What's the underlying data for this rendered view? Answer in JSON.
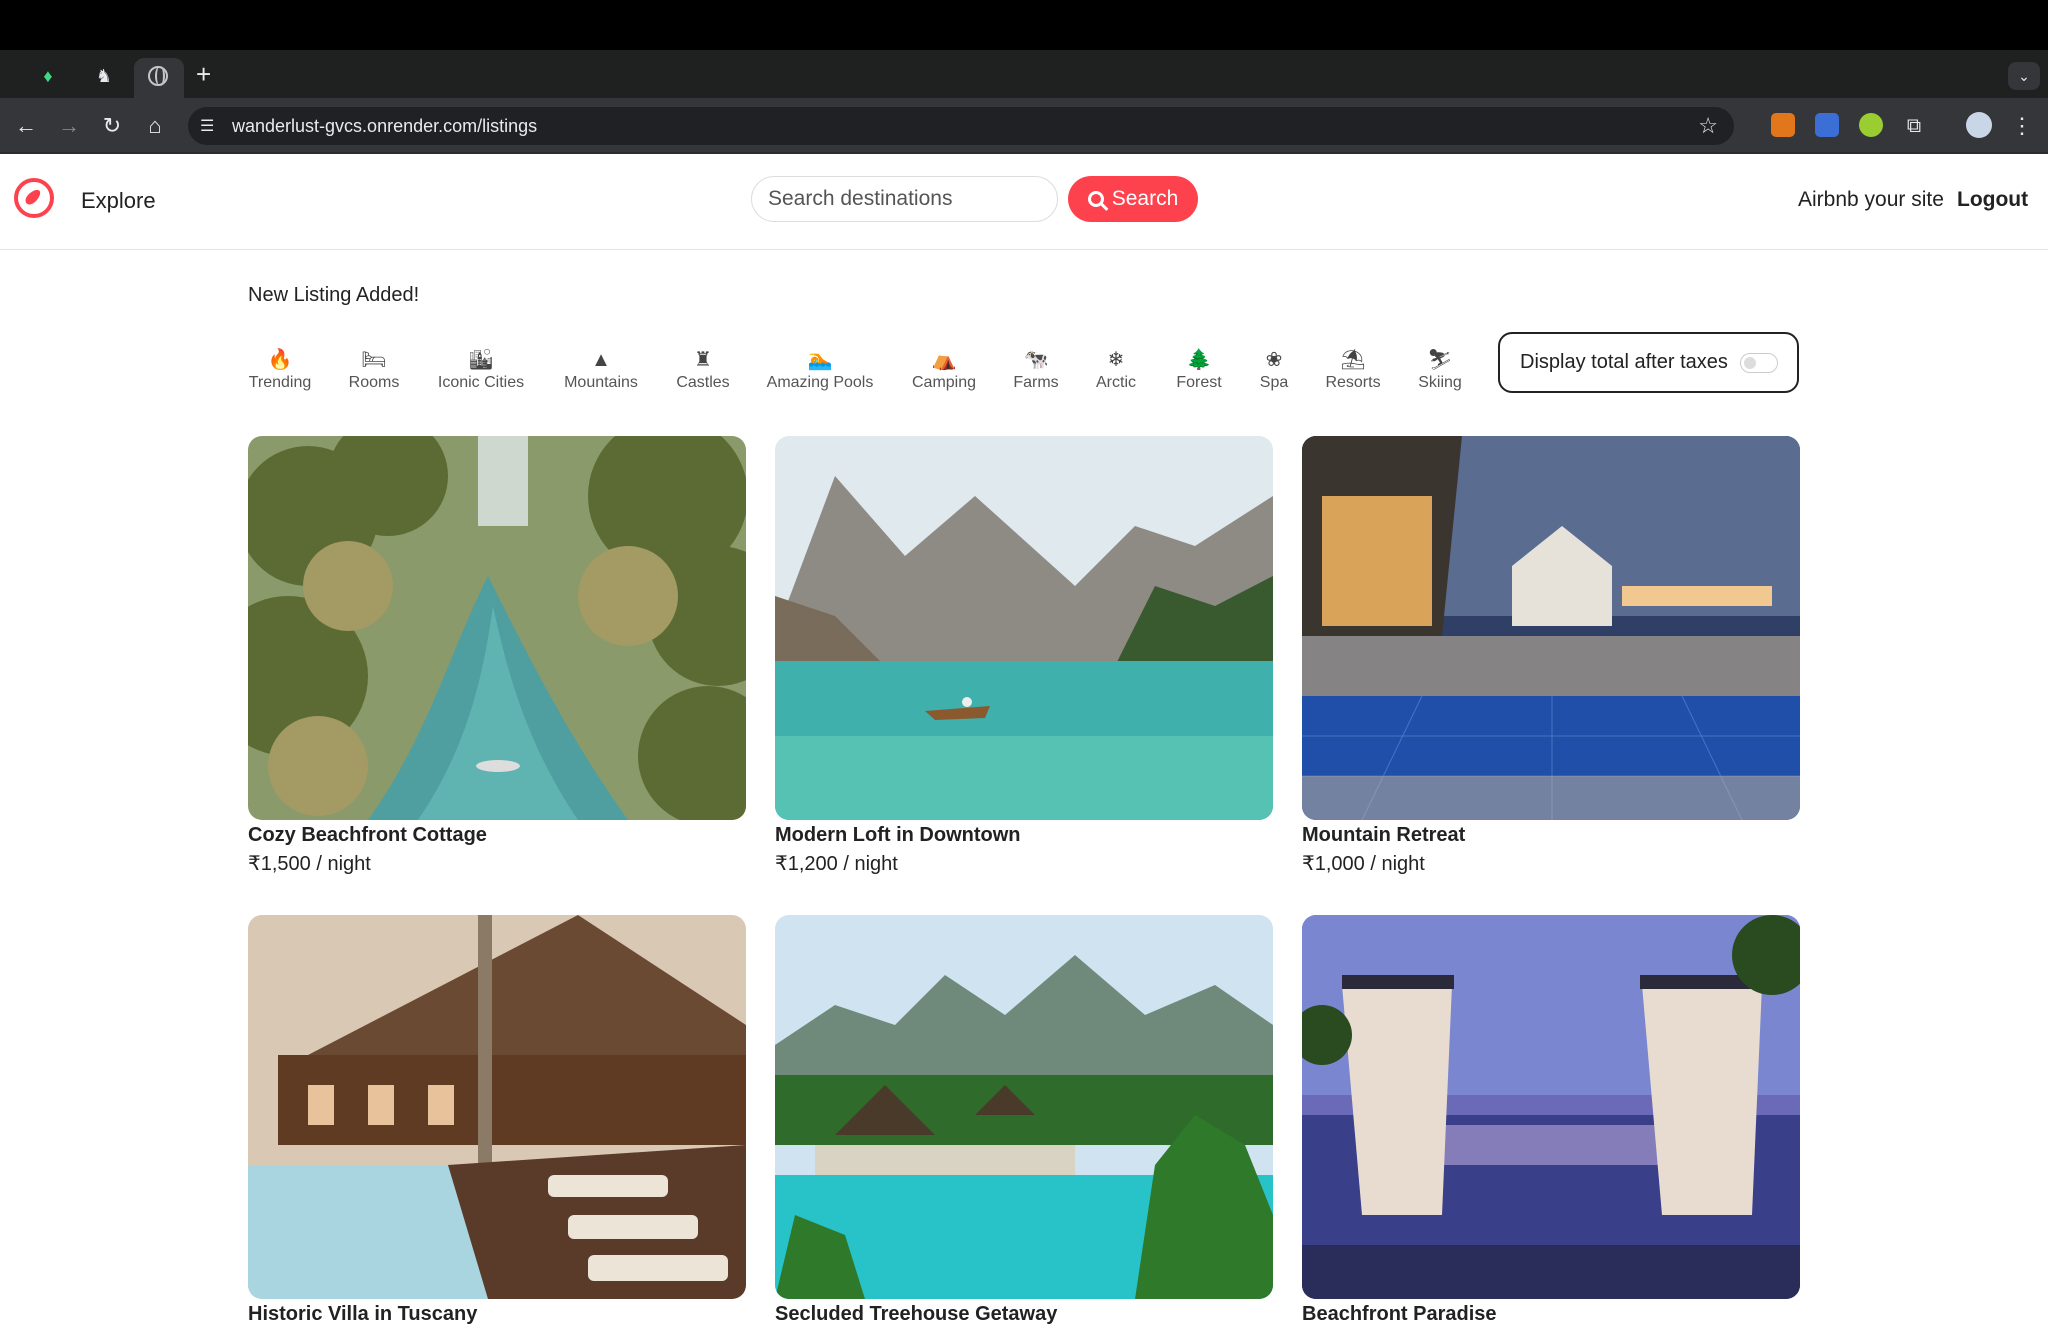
{
  "browser": {
    "url": "wanderlust-gvcs.onrender.com/listings"
  },
  "nav": {
    "explore": "Explore",
    "search_placeholder": "Search destinations",
    "search_button": "Search",
    "host_link": "Airbnb your site",
    "logout": "Logout"
  },
  "flash": "New Listing Added!",
  "filters": [
    {
      "label": "Trending",
      "icon": "fire-icon",
      "glyph": "🔥"
    },
    {
      "label": "Rooms",
      "icon": "bed-icon",
      "glyph": "🛏"
    },
    {
      "label": "Iconic Cities",
      "icon": "city-icon",
      "glyph": "🏙"
    },
    {
      "label": "Mountains",
      "icon": "mountain-icon",
      "glyph": "▲"
    },
    {
      "label": "Castles",
      "icon": "castle-icon",
      "glyph": "♜"
    },
    {
      "label": "Amazing Pools",
      "icon": "swimmer-icon",
      "glyph": "🏊"
    },
    {
      "label": "Camping",
      "icon": "tent-icon",
      "glyph": "⛺"
    },
    {
      "label": "Farms",
      "icon": "cow-icon",
      "glyph": "🐄"
    },
    {
      "label": "Arctic",
      "icon": "snowflake-icon",
      "glyph": "❄"
    },
    {
      "label": "Forest",
      "icon": "tree-icon",
      "glyph": "🌲"
    },
    {
      "label": "Spa",
      "icon": "spa-icon",
      "glyph": "❀"
    },
    {
      "label": "Resorts",
      "icon": "umbrella-beach-icon",
      "glyph": "⛱"
    },
    {
      "label": "Skiing",
      "icon": "skiing-icon",
      "glyph": "⛷"
    }
  ],
  "tax_toggle_label": "Display total after taxes",
  "tax_toggle_on": false,
  "listings": [
    {
      "title": "Cozy Beachfront Cottage",
      "price": "₹1,500 / night",
      "image": "tropical-river-palms"
    },
    {
      "title": "Modern Loft in Downtown",
      "price": "₹1,200 / night",
      "image": "mountain-lake-boat"
    },
    {
      "title": "Mountain Retreat",
      "price": "₹1,000 / night",
      "image": "resort-pool-night"
    },
    {
      "title": "Historic Villa in Tuscany",
      "price": "",
      "image": "wooden-lodge-pool"
    },
    {
      "title": "Secluded Treehouse Getaway",
      "price": "",
      "image": "tropical-pool-huts"
    },
    {
      "title": "Beachfront Paradise",
      "price": "",
      "image": "cabana-infinity-pool"
    }
  ]
}
